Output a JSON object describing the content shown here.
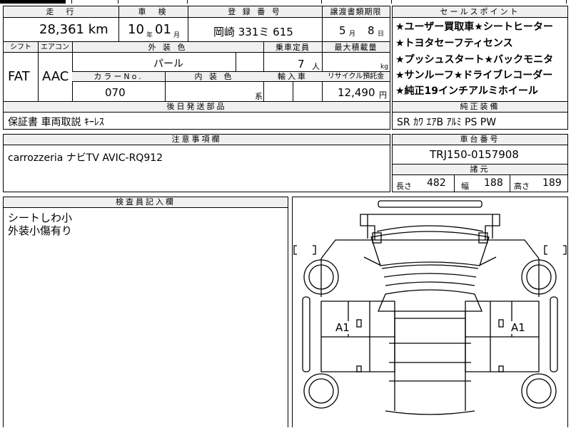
{
  "header": {
    "mileage_label": "走　行",
    "inspection_label": "車　検",
    "registration_label": "登 録 番 号",
    "transfer_label": "譲渡書類期限",
    "selling_points_label": "セールスポイント"
  },
  "row1": {
    "mileage": "28,361 km",
    "inspection_year": "10",
    "year_unit": "年",
    "inspection_month": "01",
    "month_unit": "月",
    "registration": "岡崎 331ミ 615",
    "transfer_month": "5",
    "transfer_month_unit": "月",
    "transfer_day": "8",
    "transfer_day_unit": "日"
  },
  "row2_labels": {
    "shift": "シフト",
    "aircon": "エアコン",
    "exterior_color": "外 装 色",
    "capacity": "乗車定員",
    "max_load": "最大積載量",
    "color_no": "カラーNo.",
    "interior_color": "内 装 色",
    "import": "輸入車",
    "recycle": "リサイクル預託金"
  },
  "row2": {
    "shift": "FAT",
    "aircon": "AAC",
    "exterior_color": "パール",
    "capacity": "7",
    "capacity_unit": "人",
    "load_unit": "kg",
    "color_no": "070",
    "interior_unit": "系",
    "recycle": "12,490",
    "recycle_unit": "円"
  },
  "selling_points": [
    "★ユーザー買取車★シートヒーター",
    "★トヨタセーフティセンス",
    "★プッシュスタート★バックモニタ",
    "★サンルーフ★ドライブレコーダー",
    "★純正19インチアルミホイール"
  ],
  "later_items": {
    "label": "後日発送部品",
    "value": "保証書 車両取説 ｷｰﾚｽ"
  },
  "standard_equipment": {
    "label": "純正装備",
    "value": "SR ｶﾜ ｴｱB ｱﾙﾐ PS PW"
  },
  "notes": {
    "label": "注意事項欄",
    "value": "carrozzeria ナビTV AVIC-RQ912"
  },
  "chassis": {
    "label": "車台番号",
    "value": "TRJ150-0157908"
  },
  "dimensions": {
    "label": "諸元",
    "length_label": "長さ",
    "length": "482",
    "width_label": "幅",
    "width": "188",
    "height_label": "高さ",
    "height": "189"
  },
  "inspector": {
    "label": "検査員記入欄",
    "lines": [
      "シートしわ小",
      "外装小傷有り"
    ]
  },
  "diagram": {
    "left_mark": "A1",
    "right_mark": "A1"
  }
}
